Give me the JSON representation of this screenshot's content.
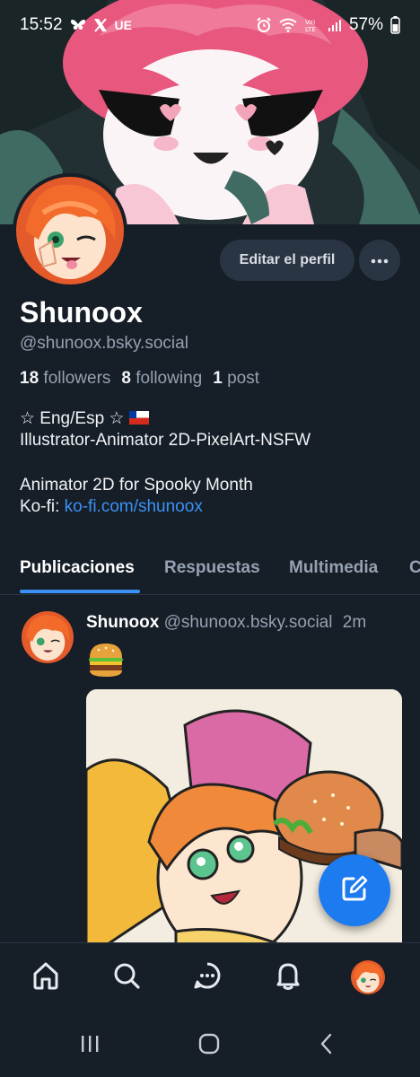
{
  "status_bar": {
    "time": "15:52",
    "carrier_label": "UE",
    "network_label": "VoLTE",
    "battery": "57%"
  },
  "profile": {
    "edit_button": "Editar el perfil",
    "display_name": "Shunoox",
    "handle": "@shunoox.bsky.social",
    "followers_count": "18",
    "followers_label": "followers",
    "following_count": "8",
    "following_label": "following",
    "posts_count": "1",
    "posts_label": "post",
    "bio_line1_prefix": "☆ Eng/Esp ☆",
    "bio_line2": "Illustrator-Animator 2D-PixelArt-NSFW",
    "bio_line3": "Animator 2D for Spooky Month",
    "bio_line4_prefix": "Ko-fi:",
    "bio_link": "ko-fi.com/shunoox"
  },
  "tabs": [
    {
      "label": "Publicaciones",
      "active": true
    },
    {
      "label": "Respuestas",
      "active": false
    },
    {
      "label": "Multimedia",
      "active": false
    },
    {
      "label": "C",
      "active": false
    }
  ],
  "post": {
    "author": "Shunoox",
    "handle": "@shunoox.bsky.social",
    "time": "2m",
    "emoji": "hamburger"
  },
  "bottom_nav": {
    "items": [
      "home-icon",
      "search-icon",
      "chat-icon",
      "notifications-icon",
      "profile-avatar"
    ]
  },
  "colors": {
    "background": "#161e27",
    "accent": "#3b91f7",
    "fab": "#1d7bf0",
    "muted_text": "#95a2b2"
  }
}
